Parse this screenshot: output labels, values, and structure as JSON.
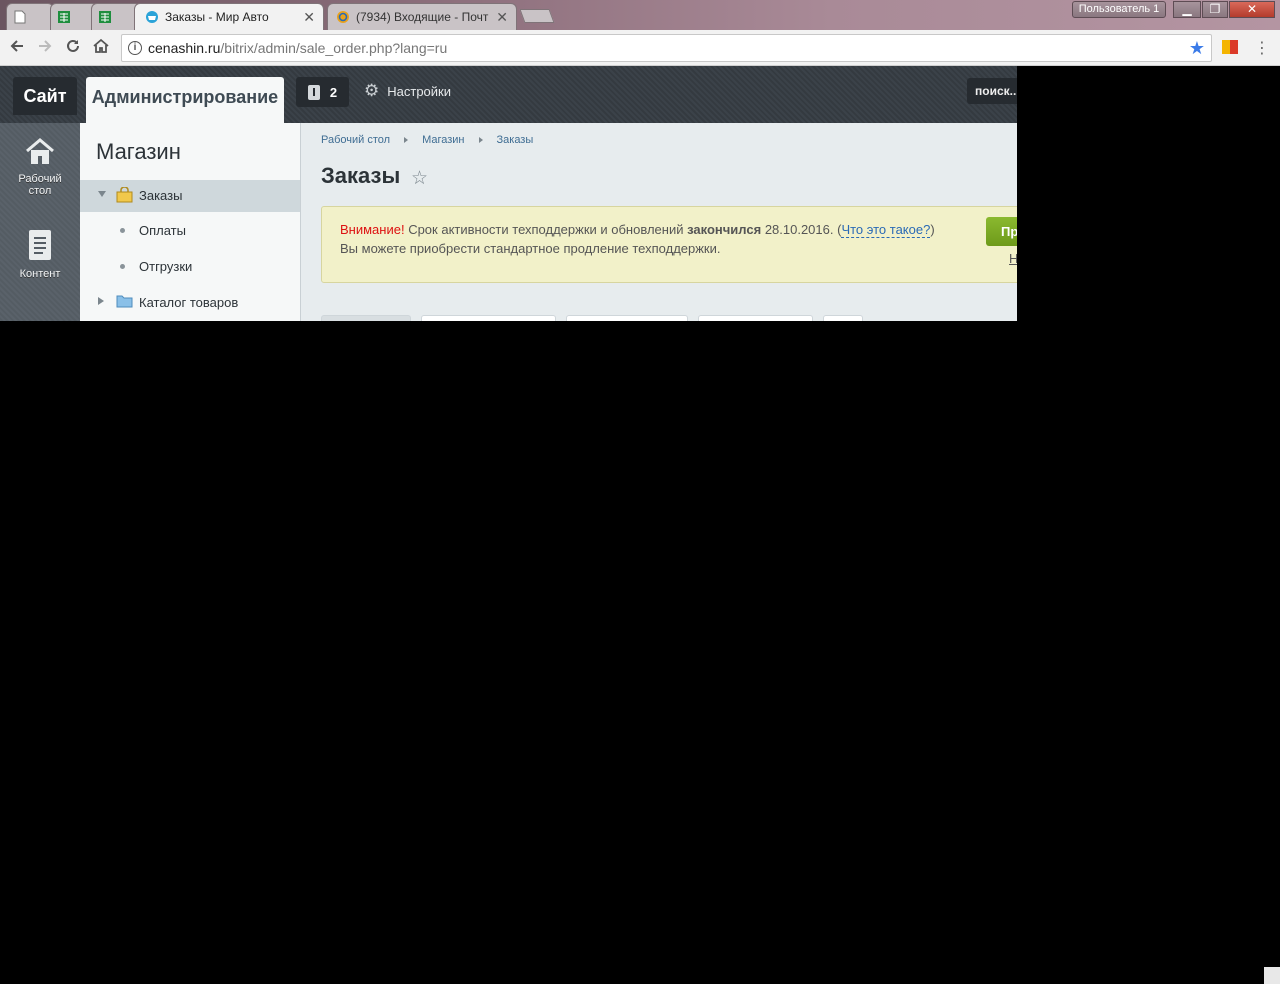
{
  "browser": {
    "tabs": [
      {
        "title": "",
        "icon": "blank-page-icon"
      },
      {
        "title": "",
        "icon": "spreadsheet-icon"
      },
      {
        "title": "",
        "icon": "spreadsheet-icon"
      },
      {
        "title": "Заказы - Мир Авто",
        "icon": "shop-basket-icon",
        "active": true
      },
      {
        "title": "(7934) Входящие - Почт",
        "icon": "mail-at-icon"
      }
    ],
    "profile_name": "Пользователь 1",
    "url_host": "cenashin.ru",
    "url_path": "/bitrix/admin/sale_order.php?lang=ru",
    "colors": {
      "accent": "#3b7be8",
      "window_close": "#c94f40"
    }
  },
  "admin": {
    "site_label": "Сайт",
    "admin_label": "Администрирование",
    "notifications_count": "2",
    "settings_label": "Настройки",
    "search_placeholder": "поиск...",
    "rail": [
      {
        "label_1": "Рабочий",
        "label_2": "стол",
        "icon": "home-icon"
      },
      {
        "label_1": "Контент",
        "icon": "document-icon"
      }
    ],
    "menu": {
      "title": "Магазин",
      "items": [
        {
          "label": "Заказы",
          "icon": "bag-icon",
          "active": true
        },
        {
          "label": "Оплаты"
        },
        {
          "label": "Отгрузки"
        },
        {
          "label": "Каталог товаров",
          "icon": "folder-icon"
        }
      ]
    },
    "breadcrumb": [
      "Рабочий стол",
      "Магазин",
      "Заказы"
    ],
    "page_title": "Заказы",
    "notice": {
      "warning": "Внимание!",
      "text_a": "Срок активности техподдержки и обновлений",
      "bold": "закончился",
      "date": "28.10.2016.",
      "link": "Что это такое?",
      "line2": "Вы можете приобрести стандартное продление техподдержки.",
      "button_text": "Пр",
      "side_link": "Н"
    },
    "colors": {
      "accent_green": "#7aa722",
      "link_blue": "#2a6ab5",
      "warning_red": "#dd1111"
    }
  }
}
